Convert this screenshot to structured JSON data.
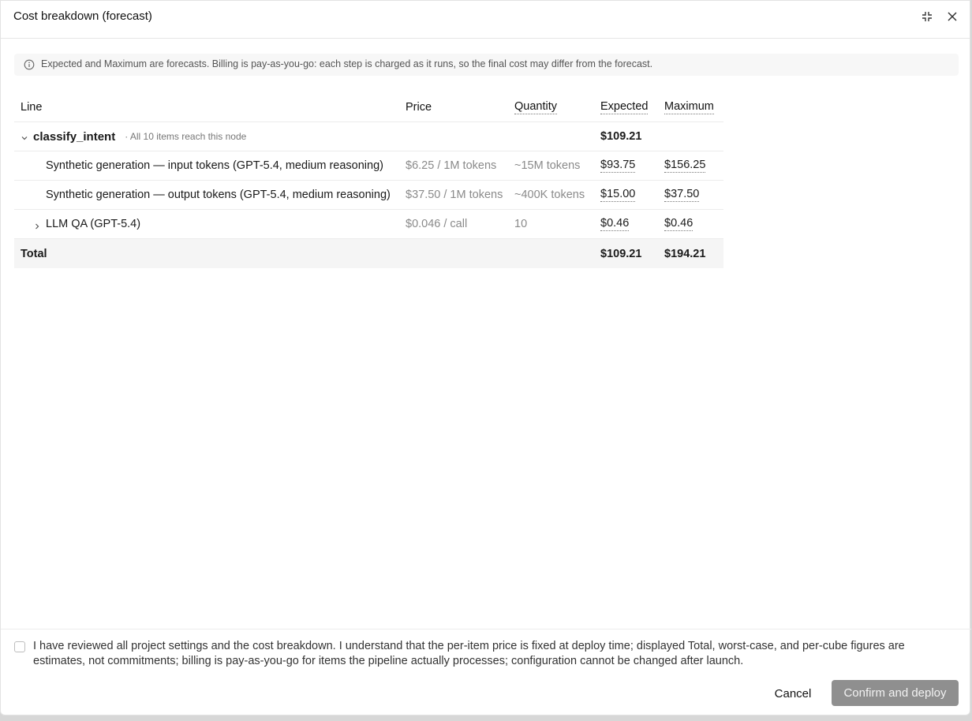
{
  "dialog": {
    "title": "Cost breakdown (forecast)",
    "notice": "Expected and Maximum are forecasts. Billing is pay-as-you-go: each step is charged as it runs, so the final cost may differ from the forecast."
  },
  "table": {
    "headers": {
      "line": "Line",
      "price": "Price",
      "quantity": "Quantity",
      "expected": "Expected",
      "maximum": "Maximum"
    },
    "node": {
      "name": "classify_intent",
      "note": "· All 10 items reach this node",
      "expected": "$109.21"
    },
    "items": [
      {
        "line": "Synthetic generation — input tokens (GPT-5.4, medium reasoning)",
        "price": "$6.25 / 1M tokens",
        "quantity": "~15M tokens",
        "expected": "$93.75",
        "maximum": "$156.25"
      },
      {
        "line": "Synthetic generation — output tokens (GPT-5.4, medium reasoning)",
        "price": "$37.50 / 1M tokens",
        "quantity": "~400K tokens",
        "expected": "$15.00",
        "maximum": "$37.50"
      },
      {
        "line": "LLM QA (GPT-5.4)",
        "price": "$0.046 / call",
        "quantity": "10",
        "expected": "$0.46",
        "maximum": "$0.46"
      }
    ],
    "total": {
      "label": "Total",
      "expected": "$109.21",
      "maximum": "$194.21"
    }
  },
  "footer": {
    "acknowledgement": "I have reviewed all project settings and the cost breakdown. I understand that the per-item price is fixed at deploy time; displayed Total, worst-case, and per-cube figures are estimates, not commitments; billing is pay-as-you-go for items the pipeline actually processes; configuration cannot be changed after launch.",
    "cancel_label": "Cancel",
    "confirm_label": "Confirm and deploy",
    "checkbox_checked": false
  },
  "icons": {
    "minimize": "collapse-icon",
    "close": "close-icon",
    "info": "info-icon",
    "expanded": "chevron-down-icon",
    "collapsed": "chevron-right-icon"
  },
  "colors": {
    "primary_disabled": "#8f8f8f",
    "notice_bg": "#f7f7f7",
    "total_bg": "#f5f5f5"
  }
}
